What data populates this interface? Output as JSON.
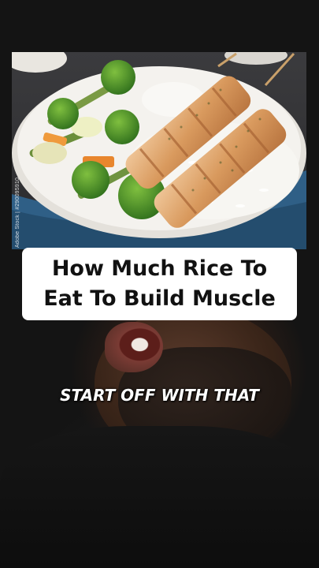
{
  "photo": {
    "watermark": "Adobe Stock | #290095910",
    "colors": {
      "plate": "#f4f2ee",
      "tablecloth": "#2f5f86",
      "rice": "#f7f6f2",
      "chicken": "#e1a56d",
      "broccoli": "#4f8f2a",
      "carrot": "#e8862d"
    }
  },
  "title": {
    "line1": "How Much Rice To",
    "line2": "Eat To Build Muscle"
  },
  "caption": "START OFF WITH THAT"
}
